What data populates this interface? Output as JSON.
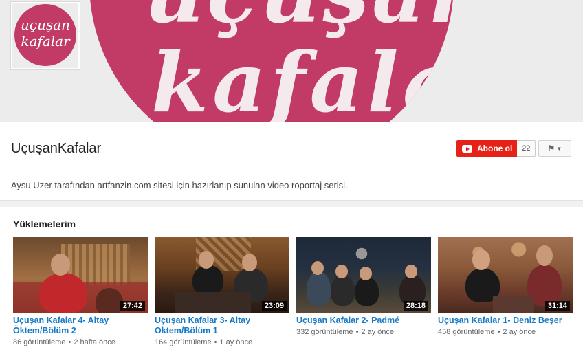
{
  "banner": {
    "line1": "uçuşan",
    "line2": "kafalar"
  },
  "avatar": {
    "line1": "uçuşan",
    "line2": "kafalar"
  },
  "channel": {
    "title": "UçuşanKafalar",
    "subscribe_label": "Abone ol",
    "subscriber_count": "22",
    "description": "Aysu Uzer tarafından artfanzin.com sitesi için hazırlanıp sunulan video roportaj serisi."
  },
  "section": {
    "title": "Yüklemelerim"
  },
  "videos": [
    {
      "title": "Uçuşan Kafalar 4- Altay Öktem/Bölüm 2",
      "duration": "27:42",
      "views": "86 görüntüleme",
      "age": "2 hafta önce"
    },
    {
      "title": "Uçuşan Kafalar 3- Altay Öktem/Bölüm 1",
      "duration": "23:09",
      "views": "164 görüntüleme",
      "age": "1 ay önce"
    },
    {
      "title": "Uçuşan Kafalar 2- Padmé",
      "duration": "28:18",
      "views": "332 görüntüleme",
      "age": "2 ay önce"
    },
    {
      "title": "Uçuşan Kafalar 1- Deniz Beşer",
      "duration": "31:14",
      "views": "458 görüntüleme",
      "age": "2 ay önce"
    }
  ],
  "colors": {
    "brand_pink": "#c23a66",
    "subscribe_red": "#e62117",
    "link_blue": "#167ac6"
  }
}
